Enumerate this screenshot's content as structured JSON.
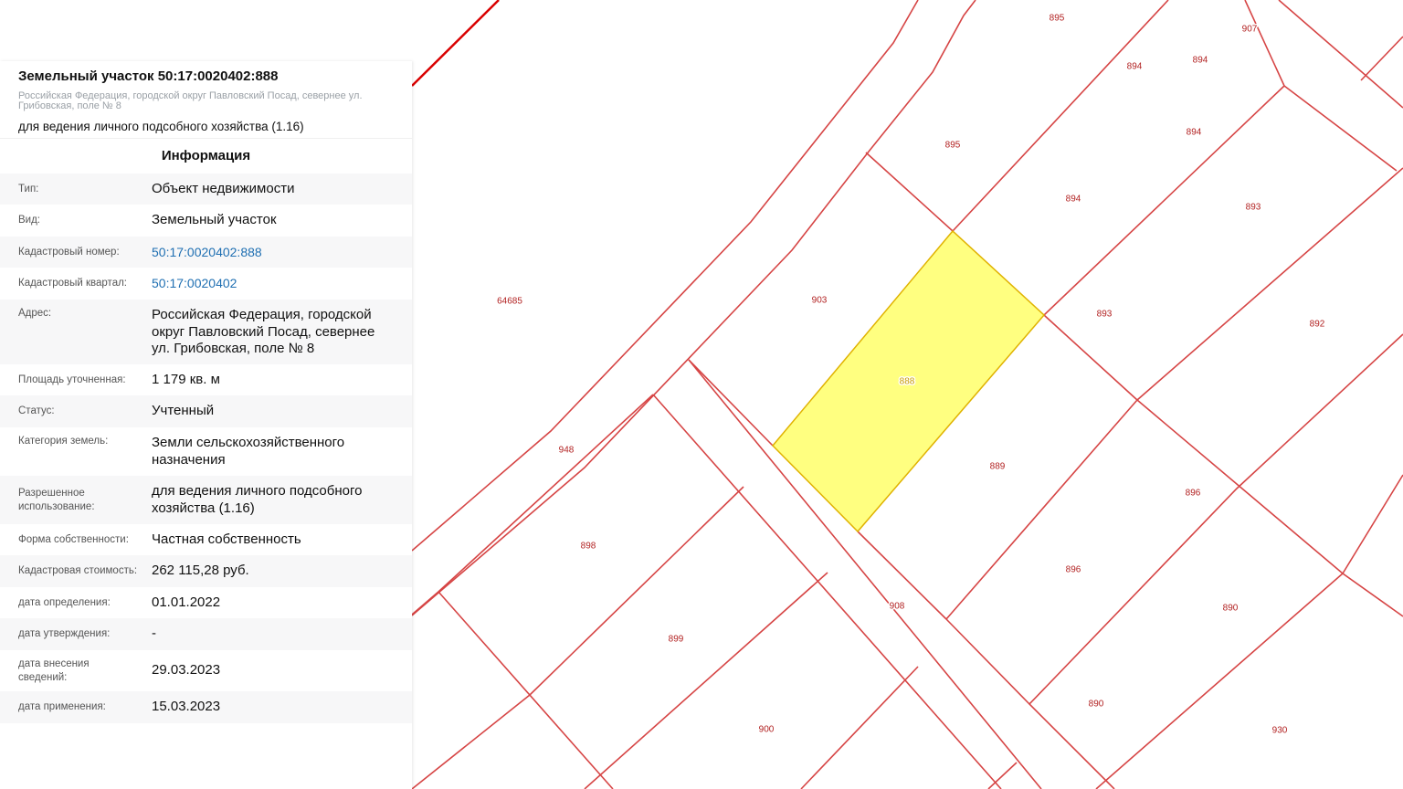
{
  "map": {
    "colors": {
      "boundary": "#d64545",
      "road_line": "#d90000",
      "selected_fill": "#ffff80",
      "selected_stroke": "#e0b200",
      "label": "#b22222"
    },
    "labels": [
      "895",
      "907",
      "894",
      "894",
      "894",
      "895",
      "894",
      "893",
      "64685",
      "903",
      "893",
      "892",
      "888",
      "948",
      "889",
      "896",
      "898",
      "896",
      "908",
      "890",
      "899",
      "890",
      "900",
      "930"
    ],
    "selected_label": "888"
  },
  "panel": {
    "title": "Земельный участок 50:17:0020402:888",
    "address_short": "Российская Федерация, городской округ Павловский Посад, севернее ул. Грибовская, поле № 8",
    "purpose": "для ведения личного подсобного хозяйства (1.16)",
    "section_title": "Информация",
    "rows": [
      {
        "label": "Тип:",
        "value": "Объект недвижимости"
      },
      {
        "label": "Вид:",
        "value": "Земельный участок"
      },
      {
        "label": "Кадастровый номер:",
        "value": "50:17:0020402:888"
      },
      {
        "label": "Кадастровый квартал:",
        "value": "50:17:0020402"
      },
      {
        "label": "Адрес:",
        "value": "Российская Федерация, городской округ Павловский Посад, севернее ул. Грибовская, поле № 8"
      },
      {
        "label": "Площадь уточненная:",
        "value": "1 179 кв. м"
      },
      {
        "label": "Статус:",
        "value": "Учтенный"
      },
      {
        "label": "Категория земель:",
        "value": "Земли сельскохозяйственного назначения"
      },
      {
        "label": "Разрешенное использование:",
        "value": "для ведения личного подсобного хозяйства (1.16)"
      },
      {
        "label": "Форма собственности:",
        "value": "Частная собственность"
      },
      {
        "label": "Кадастровая стоимость:",
        "value": "262 115,28 руб."
      },
      {
        "label": "дата определения:",
        "value": "01.01.2022"
      },
      {
        "label": "дата утверждения:",
        "value": "-"
      },
      {
        "label": "дата внесения сведений:",
        "value": "29.03.2023"
      },
      {
        "label": "дата применения:",
        "value": "15.03.2023"
      }
    ]
  }
}
